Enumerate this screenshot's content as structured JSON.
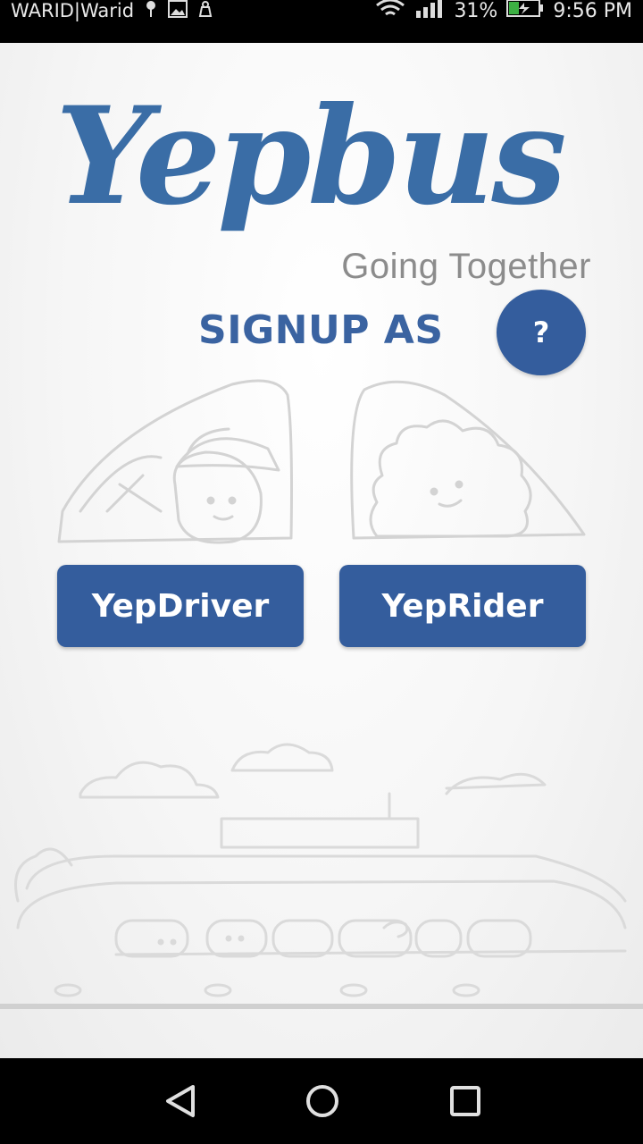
{
  "status_bar": {
    "carrier": "WARID|Warid",
    "battery_percent": "31%",
    "time": "9:56 PM",
    "icons": [
      "notification-icon",
      "image-icon",
      "upload-icon",
      "wifi-icon",
      "signal-icon",
      "battery-charging-icon"
    ]
  },
  "logo": {
    "wordmark": "Yepbus",
    "tagline": "Going Together"
  },
  "signup": {
    "title": "SIGNUP AS",
    "help_label": "?"
  },
  "roles": {
    "driver_label": "YepDriver",
    "rider_label": "YepRider"
  },
  "nav": {
    "icons": [
      "back-icon",
      "home-icon",
      "recents-icon"
    ]
  },
  "colors": {
    "brand_blue": "#345d9d",
    "logo_blue": "#3a6da6",
    "tagline_gray": "#8c8c8c",
    "illustration_stroke": "#d3d3d3"
  }
}
